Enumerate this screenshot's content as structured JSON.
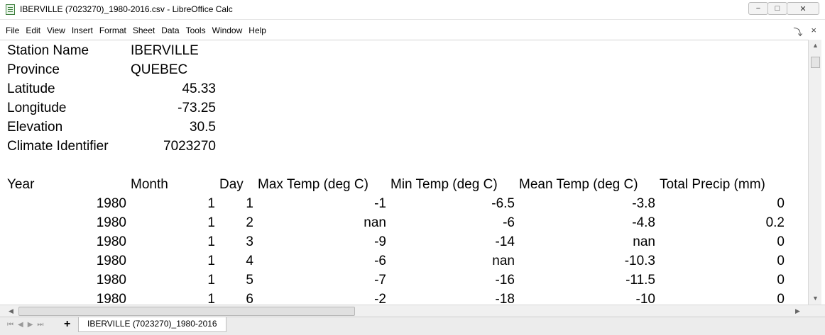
{
  "window": {
    "title": "IBERVILLE (7023270)_1980-2016.csv - LibreOffice Calc"
  },
  "menu": [
    "File",
    "Edit",
    "View",
    "Insert",
    "Format",
    "Sheet",
    "Data",
    "Tools",
    "Window",
    "Help"
  ],
  "sheet": {
    "meta": [
      {
        "label": "Station Name",
        "value": "IBERVILLE"
      },
      {
        "label": "Province",
        "value": "QUEBEC"
      },
      {
        "label": "Latitude",
        "value": "45.33"
      },
      {
        "label": "Longitude",
        "value": "-73.25"
      },
      {
        "label": "Elevation",
        "value": "30.5"
      },
      {
        "label": "Climate Identifier",
        "value": "7023270"
      }
    ],
    "headers": [
      "Year",
      "Month",
      "Day",
      "Max Temp (deg C)",
      "Min Temp (deg C)",
      "Mean Temp (deg C)",
      "Total Precip (mm)"
    ],
    "rows": [
      [
        "1980",
        "1",
        "1",
        "-1",
        "-6.5",
        "-3.8",
        "0"
      ],
      [
        "1980",
        "1",
        "2",
        "nan",
        "-6",
        "-4.8",
        "0.2"
      ],
      [
        "1980",
        "1",
        "3",
        "-9",
        "-14",
        "nan",
        "0"
      ],
      [
        "1980",
        "1",
        "4",
        "-6",
        "nan",
        "-10.3",
        "0"
      ],
      [
        "1980",
        "1",
        "5",
        "-7",
        "-16",
        "-11.5",
        "0"
      ],
      [
        "1980",
        "1",
        "6",
        "-2",
        "-18",
        "-10",
        "0"
      ]
    ]
  },
  "tabs": {
    "active": "IBERVILLE (7023270)_1980-2016",
    "add": "+"
  },
  "icons": {
    "minimize": "−",
    "maximize": "□",
    "close": "✕",
    "doc_close": "×",
    "split": "⤵"
  }
}
